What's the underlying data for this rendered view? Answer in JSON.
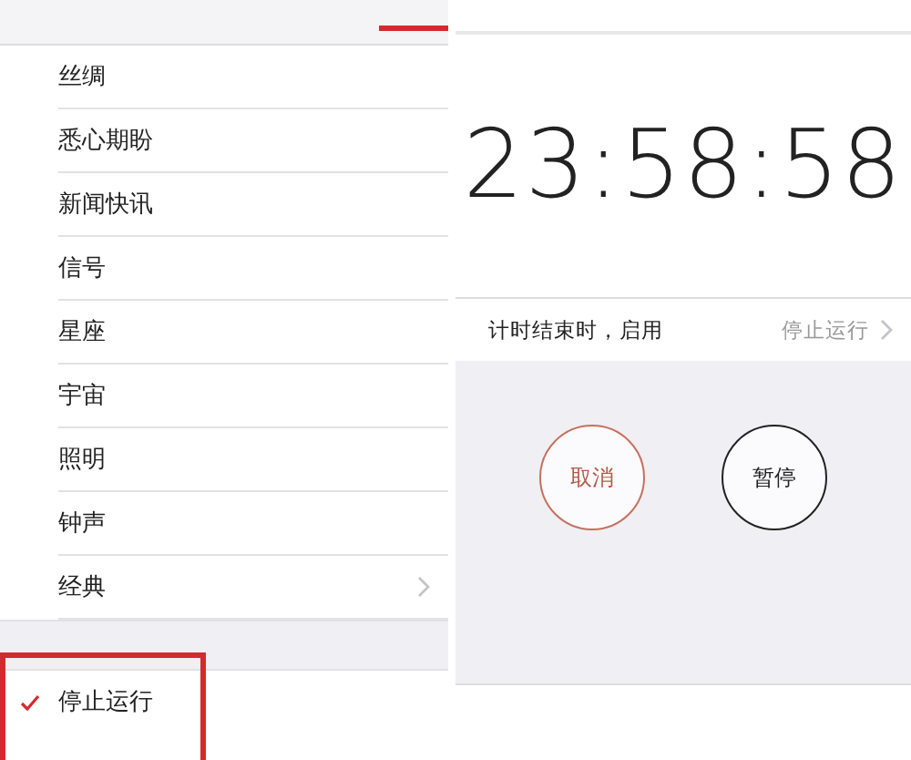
{
  "tone_list": {
    "items": [
      {
        "label": "丝绸",
        "kind": "tone",
        "selected": false
      },
      {
        "label": "悉心期盼",
        "kind": "tone",
        "selected": false
      },
      {
        "label": "新闻快讯",
        "kind": "tone",
        "selected": false
      },
      {
        "label": "信号",
        "kind": "tone",
        "selected": false
      },
      {
        "label": "星座",
        "kind": "tone",
        "selected": false
      },
      {
        "label": "宇宙",
        "kind": "tone",
        "selected": false
      },
      {
        "label": "照明",
        "kind": "tone",
        "selected": false
      },
      {
        "label": "钟声",
        "kind": "tone",
        "selected": false
      },
      {
        "label": "经典",
        "kind": "submenu",
        "selected": false
      }
    ],
    "actions": [
      {
        "label": "停止运行",
        "selected": true
      }
    ]
  },
  "timer": {
    "time": "23:58:58",
    "end_action": {
      "label": "计时结束时，启用",
      "value": "停止运行"
    },
    "buttons": [
      {
        "label": "取消",
        "kind": "cancel"
      },
      {
        "label": "暂停",
        "kind": "pause"
      }
    ]
  }
}
